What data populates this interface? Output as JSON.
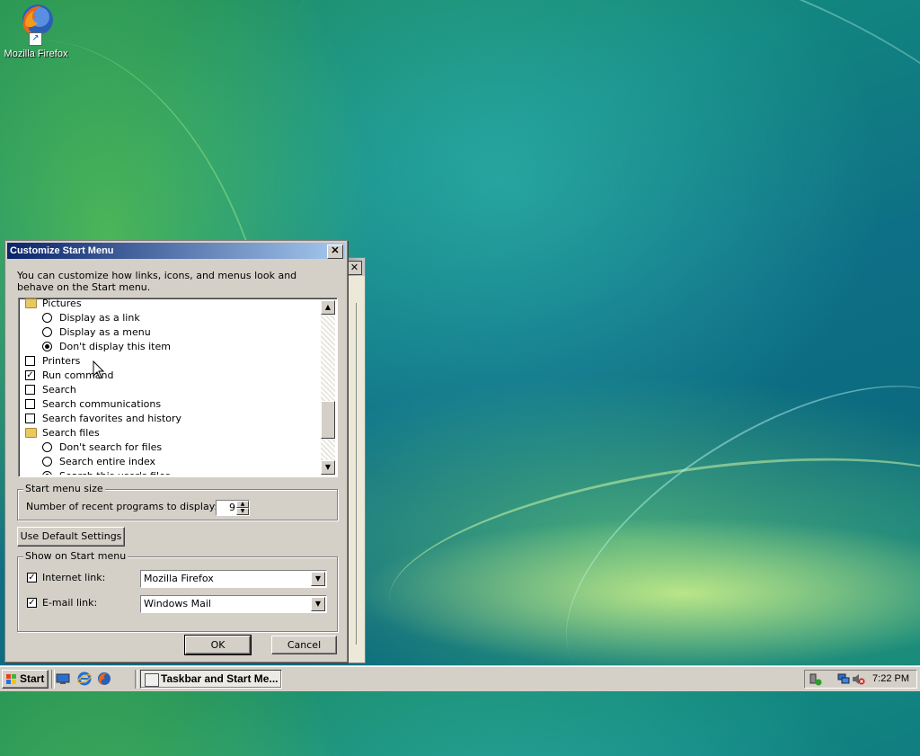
{
  "desktop": {
    "icons": [
      {
        "label": "Mozilla Firefox",
        "icon": "firefox-icon"
      }
    ]
  },
  "dialog": {
    "title": "Customize Start Menu",
    "close_label": "✕",
    "description": "You can customize how links, icons, and menus look and behave on the Start menu.",
    "list_items": [
      {
        "kind": "folder",
        "label": "Pictures",
        "indent": 0
      },
      {
        "kind": "radio",
        "label": "Display as a link",
        "checked": false,
        "indent": 1
      },
      {
        "kind": "radio",
        "label": "Display as a menu",
        "checked": false,
        "indent": 1
      },
      {
        "kind": "radio",
        "label": "Don't display this item",
        "checked": true,
        "indent": 1
      },
      {
        "kind": "checkbox",
        "label": "Printers",
        "checked": false,
        "indent": 0
      },
      {
        "kind": "checkbox",
        "label": "Run command",
        "checked": true,
        "indent": 0
      },
      {
        "kind": "checkbox",
        "label": "Search",
        "checked": false,
        "indent": 0
      },
      {
        "kind": "checkbox",
        "label": "Search communications",
        "checked": false,
        "indent": 0
      },
      {
        "kind": "checkbox",
        "label": "Search favorites and history",
        "checked": false,
        "indent": 0
      },
      {
        "kind": "folder",
        "label": "Search files",
        "indent": 0
      },
      {
        "kind": "radio",
        "label": "Don't search for files",
        "checked": false,
        "indent": 1
      },
      {
        "kind": "radio",
        "label": "Search entire index",
        "checked": false,
        "indent": 1
      },
      {
        "kind": "radio",
        "label": "Search this user's files",
        "checked": true,
        "indent": 1
      }
    ],
    "start_menu_size": {
      "group_label": "Start menu size",
      "recent_label": "Number of recent programs to display:",
      "recent_value": "9"
    },
    "default_button": "Use Default Settings",
    "show_on_start": {
      "group_label": "Show on Start menu",
      "internet_label": "Internet link:",
      "internet_checked": true,
      "internet_value": "Mozilla Firefox",
      "email_label": "E-mail link:",
      "email_checked": true,
      "email_value": "Windows Mail"
    },
    "ok_label": "OK",
    "cancel_label": "Cancel"
  },
  "taskbar": {
    "start_label": "Start",
    "quick_launch": [
      "show-desktop-icon",
      "internet-explorer-icon",
      "firefox-icon"
    ],
    "tasks": [
      {
        "label": "Taskbar and Start Me...",
        "active": true
      }
    ],
    "tray_icons": [
      "safely-remove-hardware-icon",
      "network-disconnected-icon",
      "volume-muted-icon"
    ],
    "clock": "7:22 PM"
  },
  "colors": {
    "titlebar_start": "#0a246a",
    "titlebar_end": "#a6caf0",
    "dialog_face": "#d4d0c8"
  }
}
